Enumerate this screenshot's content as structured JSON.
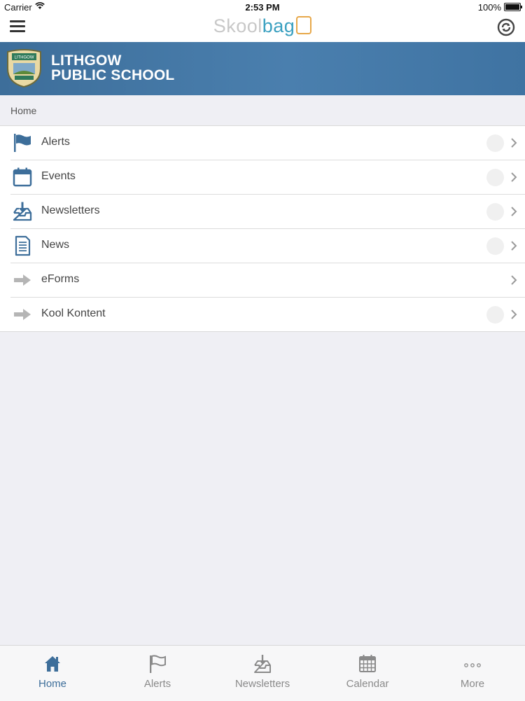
{
  "status_bar": {
    "carrier": "Carrier",
    "time": "2:53 PM",
    "battery": "100%"
  },
  "nav": {
    "brand_part1": "Skool",
    "brand_part2": "bag",
    "menu_icon": "hamburger-menu-icon",
    "sync_icon": "sync-icon"
  },
  "school": {
    "name_line1": "LITHGOW",
    "name_line2": "PUBLIC SCHOOL",
    "crest_text": "LITHGOW"
  },
  "breadcrumb": "Home",
  "menu": {
    "items": [
      {
        "label": "Alerts",
        "icon": "flag-icon"
      },
      {
        "label": "Events",
        "icon": "calendar-icon"
      },
      {
        "label": "Newsletters",
        "icon": "inbox-download-icon"
      },
      {
        "label": "News",
        "icon": "document-icon"
      },
      {
        "label": "eForms",
        "icon": "arrow-right-icon"
      },
      {
        "label": "Kool Kontent",
        "icon": "arrow-right-icon"
      }
    ]
  },
  "tabs": [
    {
      "label": "Home",
      "icon": "home-icon",
      "active": true
    },
    {
      "label": "Alerts",
      "icon": "flag-icon"
    },
    {
      "label": "Newsletters",
      "icon": "inbox-download-icon"
    },
    {
      "label": "Calendar",
      "icon": "calendar-grid-icon"
    },
    {
      "label": "More",
      "icon": "more-dots-icon"
    }
  ],
  "colors": {
    "brand_blue": "#3d6e9a",
    "brand_teal": "#3aa0c0",
    "brand_grey": "#c8c8c8",
    "brand_orange": "#e7a84a"
  }
}
